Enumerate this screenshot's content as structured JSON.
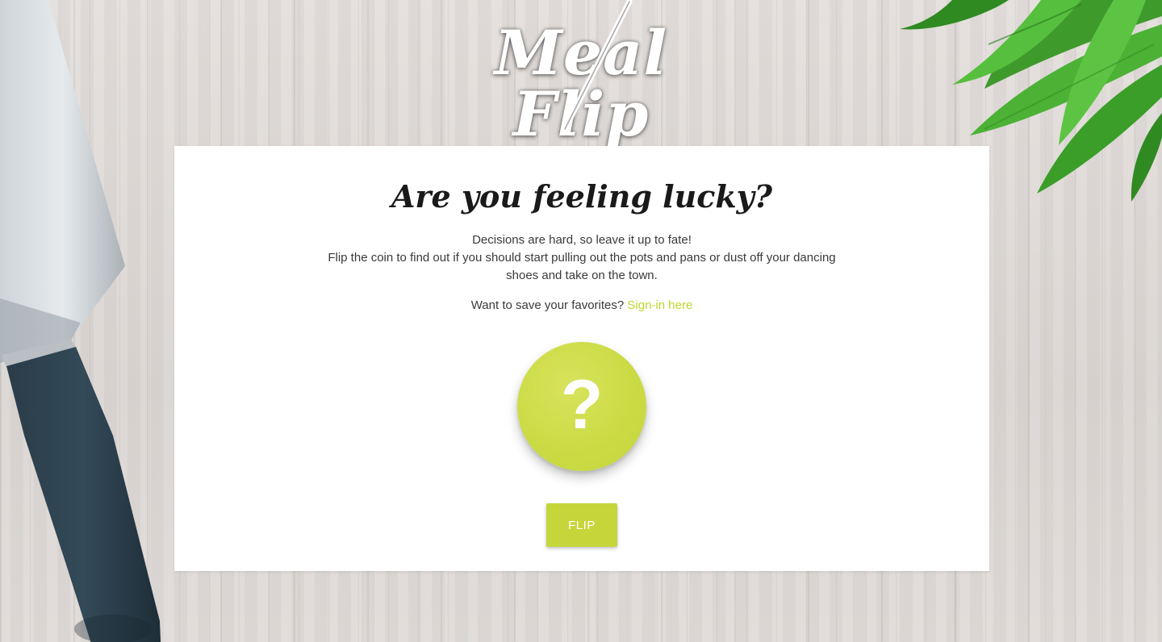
{
  "brand": {
    "logo_text": "Meal Flip",
    "accent_color": "#c5d63b",
    "link_color": "#c2d42f"
  },
  "card": {
    "title": "Are you feeling lucky?",
    "description_line1": "Decisions are hard, so leave it up to fate!",
    "description_line2": "Flip the coin to find out if you should start pulling out the pots and pans or dust off your dancing shoes and take on the town.",
    "signin_prompt": "Want to save your favorites?",
    "signin_link": "Sign-in here"
  },
  "coin": {
    "glyph": "?",
    "icon": "question-mark-icon"
  },
  "flip_button": {
    "label": "FLIP"
  }
}
